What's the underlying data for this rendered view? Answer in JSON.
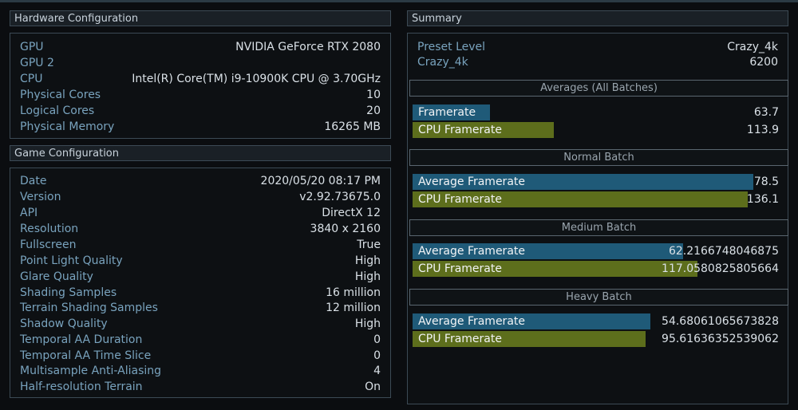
{
  "hardware": {
    "title": "Hardware Configuration",
    "rows": [
      {
        "label": "GPU",
        "value": "NVIDIA GeForce RTX 2080"
      },
      {
        "label": "GPU 2",
        "value": ""
      },
      {
        "label": "CPU",
        "value": "Intel(R) Core(TM) i9-10900K CPU @ 3.70GHz"
      },
      {
        "label": "Physical Cores",
        "value": "10"
      },
      {
        "label": "Logical Cores",
        "value": "20"
      },
      {
        "label": "Physical Memory",
        "value": "16265 MB"
      }
    ]
  },
  "game": {
    "title": "Game Configuration",
    "rows": [
      {
        "label": "Date",
        "value": "2020/05/20 08:17 PM"
      },
      {
        "label": "Version",
        "value": "v2.92.73675.0"
      },
      {
        "label": "API",
        "value": "DirectX 12"
      },
      {
        "label": "Resolution",
        "value": "3840 x 2160"
      },
      {
        "label": "Fullscreen",
        "value": "True"
      },
      {
        "label": "Point Light Quality",
        "value": "High"
      },
      {
        "label": "Glare Quality",
        "value": "High"
      },
      {
        "label": "Shading Samples",
        "value": "16 million"
      },
      {
        "label": "Terrain Shading Samples",
        "value": "12 million"
      },
      {
        "label": "Shadow Quality",
        "value": "High"
      },
      {
        "label": "Temporal AA Duration",
        "value": "0"
      },
      {
        "label": "Temporal AA Time Slice",
        "value": "0"
      },
      {
        "label": "Multisample Anti-Aliasing",
        "value": "4"
      },
      {
        "label": "Half-resolution Terrain",
        "value": "On"
      }
    ]
  },
  "summary": {
    "title": "Summary",
    "preset_label": "Preset Level",
    "preset_value": "Crazy_4k",
    "score_label": "Crazy_4k",
    "score_value": "6200",
    "sections": [
      {
        "title": "Averages (All Batches)",
        "bars": [
          {
            "label": "Framerate",
            "value": "63.7",
            "fraction": 0.211,
            "color": "#1f5a78"
          },
          {
            "label": "CPU Framerate",
            "value": "113.9",
            "fraction": 0.383,
            "color": "#5d6e1c"
          }
        ]
      },
      {
        "title": "Normal Batch",
        "bars": [
          {
            "label": "Average Framerate",
            "value": "78.5",
            "fraction": 0.924,
            "color": "#1f5a78"
          },
          {
            "label": "CPU Framerate",
            "value": "136.1",
            "fraction": 0.909,
            "color": "#5d6e1c"
          }
        ]
      },
      {
        "title": "Medium Batch",
        "bars": [
          {
            "label": "Average Framerate",
            "value": "62.2166748046875",
            "fraction": 0.734,
            "color": "#1f5a78"
          },
          {
            "label": "CPU Framerate",
            "value": "117.0580825805664",
            "fraction": 0.773,
            "color": "#5d6e1c"
          }
        ]
      },
      {
        "title": "Heavy Batch",
        "bars": [
          {
            "label": "Average Framerate",
            "value": "54.68061065673828",
            "fraction": 0.645,
            "color": "#1f5a78"
          },
          {
            "label": "CPU Framerate",
            "value": "95.61636352539062",
            "fraction": 0.632,
            "color": "#5d6e1c"
          }
        ]
      }
    ]
  }
}
